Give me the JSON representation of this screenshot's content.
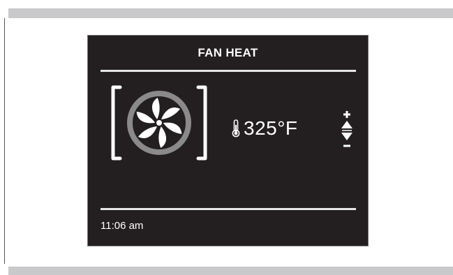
{
  "display": {
    "mode_title": "FAN HEAT",
    "temperature": "325°F",
    "time": "11:06 am"
  },
  "icons": {
    "fan": "fan-icon",
    "thermometer": "thermometer-icon",
    "adjust": "temperature-adjust-icon"
  },
  "colors": {
    "screen_background": "#231f20",
    "foreground": "#ffffff",
    "fan_ring": "#8a8a8a",
    "page_rule": "#c9c9cb"
  }
}
